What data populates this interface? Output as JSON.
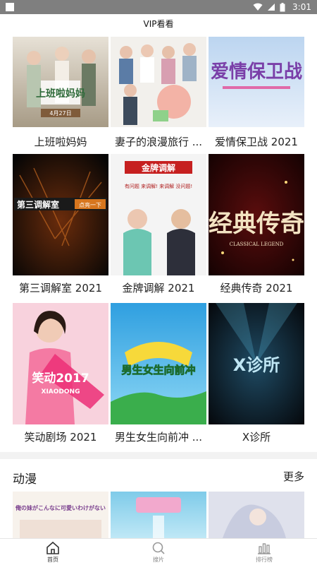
{
  "status_bar": {
    "time": "3:01"
  },
  "app": {
    "title": "VIP看看"
  },
  "featured": [
    [
      {
        "title": "上班啦妈妈",
        "poster_text": "上班啦妈妈",
        "date_text": "4月27日",
        "colors": [
          "#d8cfc2",
          "#7f8a74"
        ]
      },
      {
        "title": "妻子的浪漫旅行 ...",
        "poster_text": "",
        "colors": [
          "#f4f4f2",
          "#e9a7a0"
        ]
      },
      {
        "title": "爱情保卫战 2021",
        "poster_text": "爱情保卫战",
        "colors": [
          "#c7d9ef",
          "#6d4aa0"
        ]
      }
    ],
    [
      {
        "title": "第三调解室 2021",
        "poster_text": "第三调解室",
        "badge_text": "点亮一下",
        "colors": [
          "#0e0e0e",
          "#b45a1c"
        ]
      },
      {
        "title": "金牌调解 2021",
        "poster_text": "金牌调解",
        "sub_text": "有问题 来调解! 来调解 没问题!",
        "colors": [
          "#f3f3f3",
          "#c21d1d"
        ]
      },
      {
        "title": "经典传奇 2021",
        "poster_text": "经典传奇",
        "badge_text": "CLASSICAL LEGEND",
        "colors": [
          "#2a0505",
          "#f2d7a0"
        ]
      }
    ],
    [
      {
        "title": "笑动剧场 2021",
        "poster_text": "笑动2017",
        "badge_text": "XIAODONG",
        "colors": [
          "#f7c5d5",
          "#d9265f"
        ]
      },
      {
        "title": "男生女生向前冲 ...",
        "poster_text": "男生女生向前冲",
        "colors": [
          "#4db7e0",
          "#2aa84a"
        ]
      },
      {
        "title": "X诊所",
        "poster_text": "X诊所",
        "colors": [
          "#0c1a26",
          "#39a3c8"
        ]
      }
    ]
  ],
  "section": {
    "name": "动漫",
    "more": "更多"
  },
  "anime": [
    {
      "poster_text": "俺の妹がこんなに可愛いわけがない",
      "colors": [
        "#f8f3ee",
        "#7a4f8a"
      ]
    },
    {
      "poster_text": "",
      "colors": [
        "#8fd1ea",
        "#d45d9c"
      ]
    },
    {
      "poster_text": "",
      "colors": [
        "#d8dbe8",
        "#9aa0be"
      ]
    }
  ],
  "nav": [
    {
      "label": "首页",
      "icon": "home-icon",
      "active": true
    },
    {
      "label": "搜片",
      "icon": "search-icon",
      "active": false
    },
    {
      "label": "排行榜",
      "icon": "chart-icon",
      "active": false
    }
  ]
}
